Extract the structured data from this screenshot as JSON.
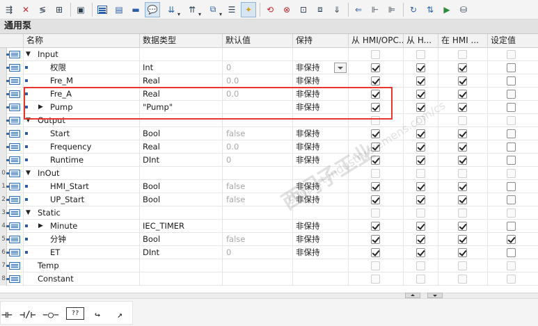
{
  "block_title": "通用泵",
  "columns": {
    "name": "名称",
    "datatype": "数据类型",
    "default": "默认值",
    "retain": "保持",
    "hmi_opc": "从 HMI/OPC...",
    "hmi_h": "从 H...",
    "in_hmi": "在 HMI ...",
    "setpoint": "设定值"
  },
  "rows": [
    {
      "num": "",
      "name": "Input",
      "type": "",
      "default": "",
      "retain": "",
      "section": true
    },
    {
      "num": "",
      "name": "权限",
      "type": "Int",
      "default": "0",
      "retain": "非保持"
    },
    {
      "num": "",
      "name": "Fre_M",
      "type": "Real",
      "default": "0.0",
      "retain": "非保持"
    },
    {
      "num": "",
      "name": "Fre_A",
      "type": "Real",
      "default": "0.0",
      "retain": "非保持"
    },
    {
      "num": "",
      "name": "Pump",
      "type": "\"Pump\"",
      "default": "",
      "retain": "非保持"
    },
    {
      "num": "",
      "name": "Output",
      "type": "",
      "default": "",
      "retain": "",
      "section": true
    },
    {
      "num": "",
      "name": "Start",
      "type": "Bool",
      "default": "false",
      "retain": "非保持"
    },
    {
      "num": "",
      "name": "Frequency",
      "type": "Real",
      "default": "0.0",
      "retain": "非保持"
    },
    {
      "num": "",
      "name": "Runtime",
      "type": "DInt",
      "default": "0",
      "retain": "非保持"
    },
    {
      "num": "0",
      "name": "InOut",
      "type": "",
      "default": "",
      "retain": "",
      "section": true
    },
    {
      "num": "1",
      "name": "HMI_Start",
      "type": "Bool",
      "default": "false",
      "retain": "非保持"
    },
    {
      "num": "2",
      "name": "UP_Start",
      "type": "Bool",
      "default": "false",
      "retain": "非保持"
    },
    {
      "num": "3",
      "name": "Static",
      "type": "",
      "default": "",
      "retain": "",
      "section": true
    },
    {
      "num": "4",
      "name": "Minute",
      "type": "IEC_TIMER",
      "default": "",
      "retain": "非保持"
    },
    {
      "num": "5",
      "name": "分钟",
      "type": "Bool",
      "default": "false",
      "retain": "非保持"
    },
    {
      "num": "6",
      "name": "ET",
      "type": "DInt",
      "default": "0",
      "retain": "非保持"
    },
    {
      "num": "7",
      "name": "Temp",
      "type": "",
      "default": "",
      "retain": "",
      "section": true
    },
    {
      "num": "8",
      "name": "Constant",
      "type": "",
      "default": "",
      "retain": "",
      "section": true
    }
  ],
  "ladder_buttons": [
    "⊣⊢",
    "⊣/⊢",
    "−○−",
    "??",
    "↪",
    "↗"
  ],
  "watermark": {
    "line1": "西门子工业",
    "line2": "support.industry.siemens.com/cs"
  }
}
